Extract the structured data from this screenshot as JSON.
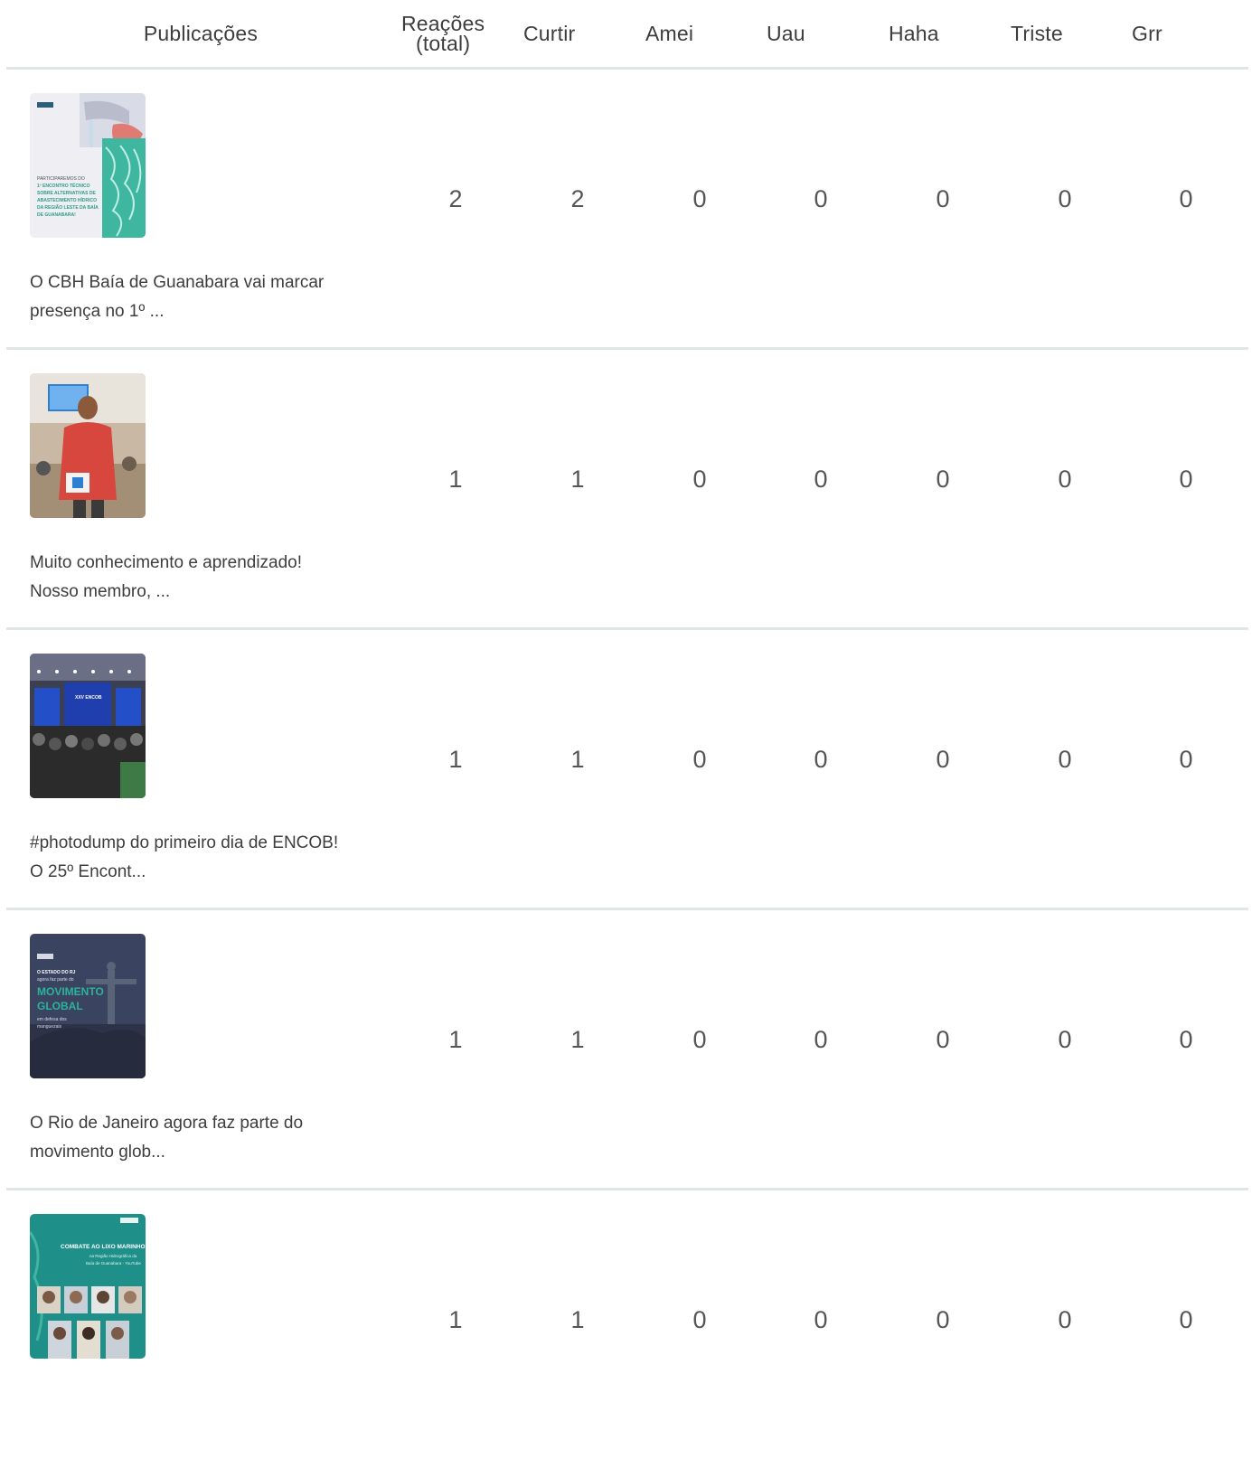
{
  "columns": {
    "publicacoes": "Publicações",
    "reacoes_line1": "Reações",
    "reacoes_line2": "(total)",
    "curtir": "Curtir",
    "amei": "Amei",
    "uau": "Uau",
    "haha": "Haha",
    "triste": "Triste",
    "grr": "Grr"
  },
  "posts": [
    {
      "caption": "O CBH Baía de Guanabara vai marcar\npresença no 1º ...",
      "thumb_text": [
        "PARTICIPAREMOS DO",
        "1º ENCONTRO TÉCNICO",
        "SOBRE ALTERNATIVAS DE",
        "ABASTECIMENTO HÍDRICO",
        "DA REGIÃO LESTE DA BAÍA",
        "DE GUANABARA!"
      ],
      "total": "2",
      "curtir": "2",
      "amei": "0",
      "uau": "0",
      "haha": "0",
      "triste": "0",
      "grr": "0"
    },
    {
      "caption": "Muito conhecimento e aprendizado!\nNosso membro, ...",
      "total": "1",
      "curtir": "1",
      "amei": "0",
      "uau": "0",
      "haha": "0",
      "triste": "0",
      "grr": "0"
    },
    {
      "caption": "#photodump do primeiro dia de ENCOB!\nO 25º Encont...",
      "thumb_text": [
        "XXV ENCOB"
      ],
      "total": "1",
      "curtir": "1",
      "amei": "0",
      "uau": "0",
      "haha": "0",
      "triste": "0",
      "grr": "0"
    },
    {
      "caption": "O Rio de Janeiro agora faz parte do\nmovimento glob...",
      "thumb_text": [
        "O ESTADO DO RJ",
        "agora faz parte do",
        "MOVIMENTO",
        "GLOBAL",
        "em defesa dos",
        "manguezais"
      ],
      "total": "1",
      "curtir": "1",
      "amei": "0",
      "uau": "0",
      "haha": "0",
      "triste": "0",
      "grr": "0"
    },
    {
      "caption": "",
      "thumb_text": [
        "COMBATE AO LIXO MARINHO",
        "na Região Hidrográfica da",
        "Baía de Guanabara - YouTube"
      ],
      "total": "1",
      "curtir": "1",
      "amei": "0",
      "uau": "0",
      "haha": "0",
      "triste": "0",
      "grr": "0"
    }
  ],
  "colors": {
    "divider": "#e0e6e6",
    "text": "#3d3d3d",
    "teal": "#2bb39a"
  }
}
